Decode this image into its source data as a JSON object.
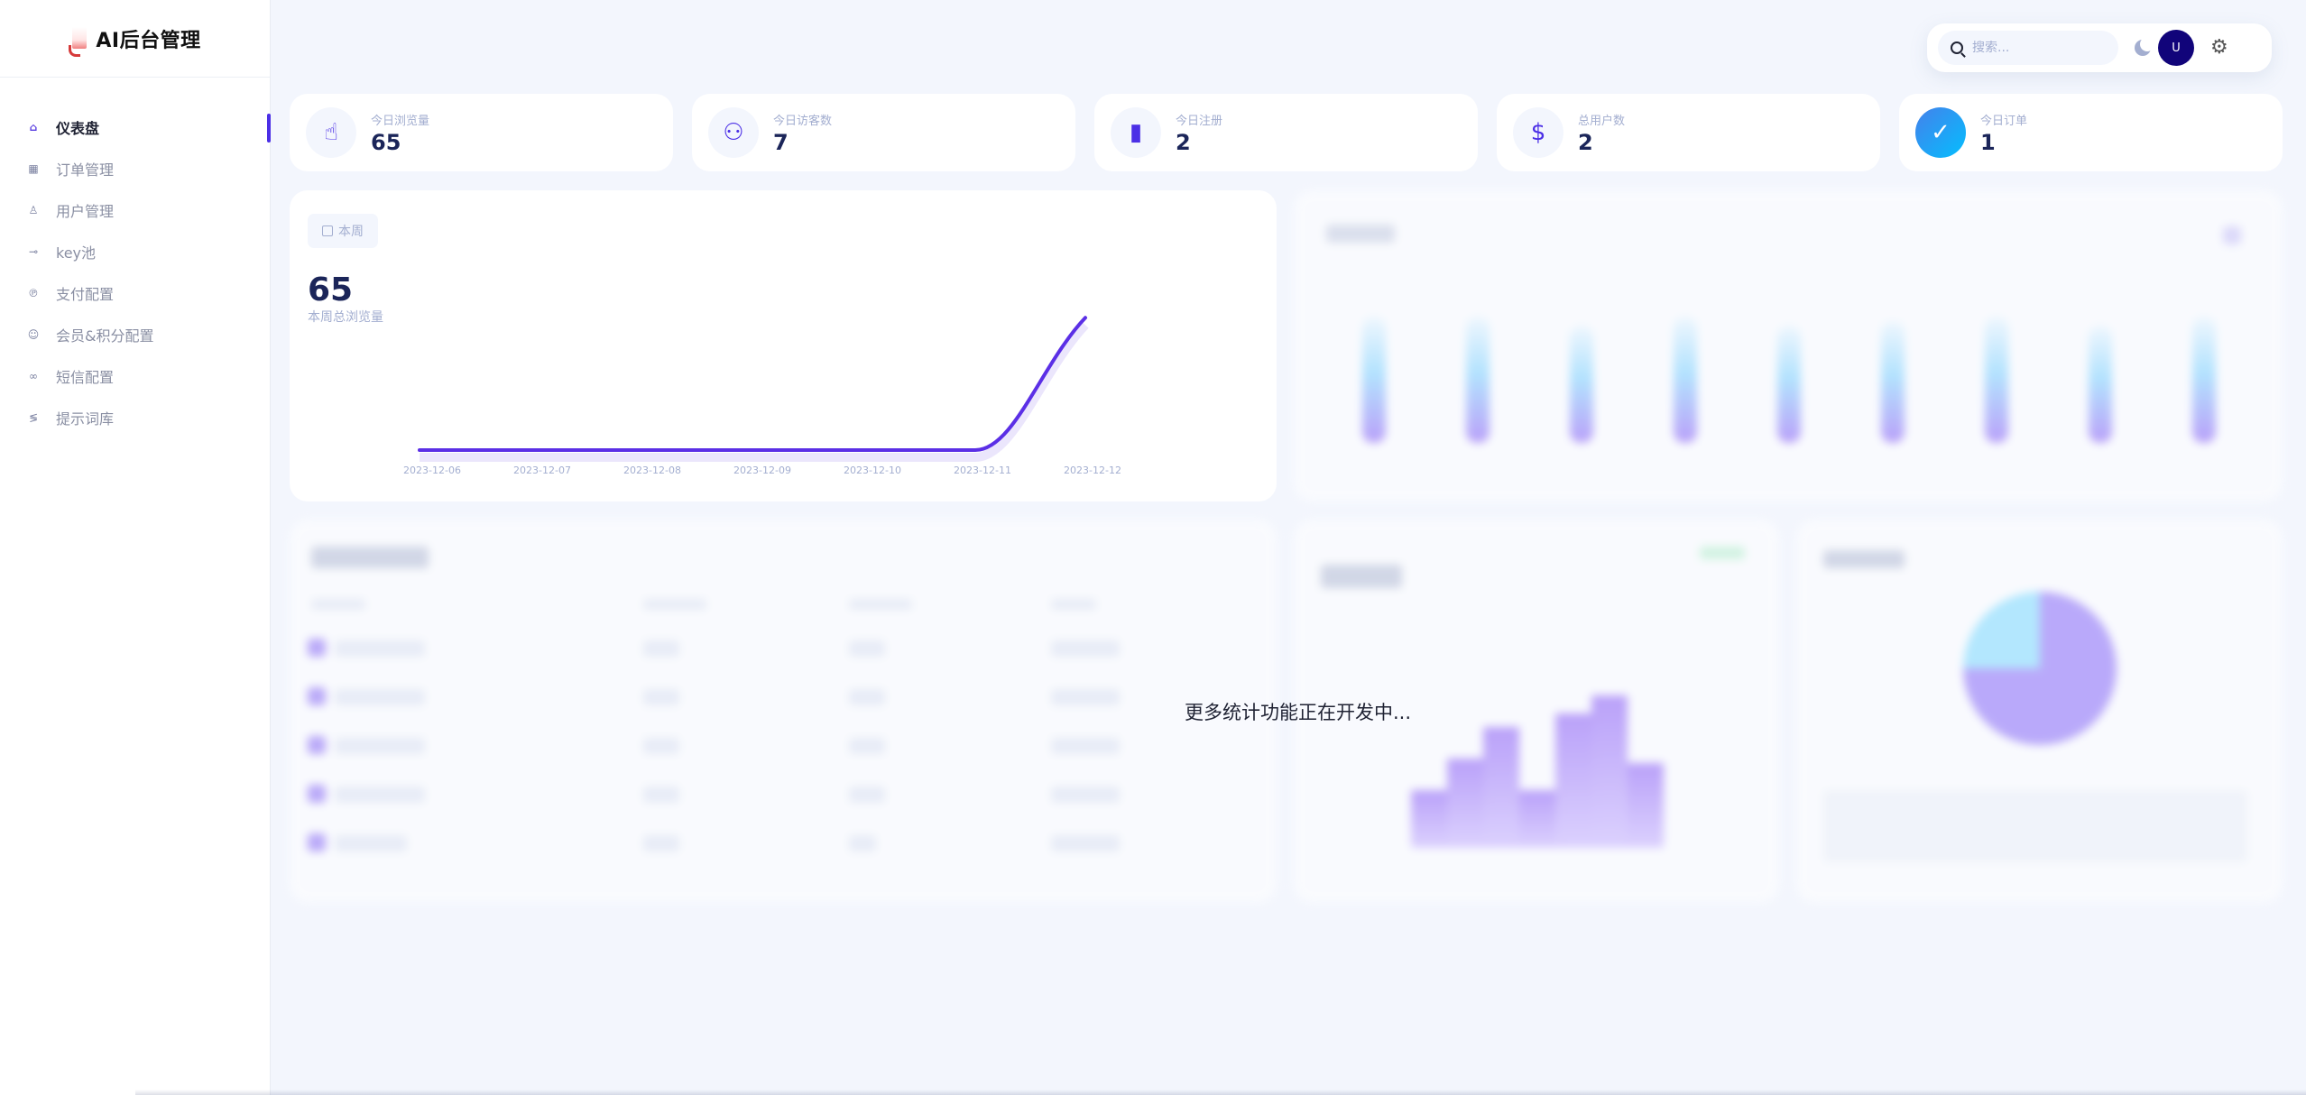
{
  "brand": {
    "title": "AI后台管理"
  },
  "sidebar": {
    "items": [
      {
        "label": "仪表盘",
        "icon": "home-icon",
        "active": true
      },
      {
        "label": "订单管理",
        "icon": "grid-icon",
        "active": false
      },
      {
        "label": "用户管理",
        "icon": "user-icon",
        "active": false
      },
      {
        "label": "key池",
        "icon": "key-icon",
        "active": false
      },
      {
        "label": "支付配置",
        "icon": "payment-icon",
        "active": false
      },
      {
        "label": "会员&积分配置",
        "icon": "member-icon",
        "active": false
      },
      {
        "label": "短信配置",
        "icon": "sms-icon",
        "active": false
      },
      {
        "label": "提示词库",
        "icon": "prompt-icon",
        "active": false
      }
    ]
  },
  "topbar": {
    "search_placeholder": "搜索...",
    "avatar_initial": "U"
  },
  "stats": [
    {
      "label": "今日浏览量",
      "value": "65",
      "icon": "hand-pointer-icon"
    },
    {
      "label": "今日访客数",
      "value": "7",
      "icon": "people-icon"
    },
    {
      "label": "今日注册",
      "value": "2",
      "icon": "bar-chart-icon"
    },
    {
      "label": "总用户数",
      "value": "2",
      "icon": "dollar-icon"
    },
    {
      "label": "今日订单",
      "value": "1",
      "icon": "check-plus-icon"
    }
  ],
  "weekly": {
    "button_label": "本周",
    "total_value": "65",
    "total_label": "本周总浏览量"
  },
  "chart_data": {
    "type": "line",
    "x": [
      "2023-12-06",
      "2023-12-07",
      "2023-12-08",
      "2023-12-09",
      "2023-12-10",
      "2023-12-11",
      "2023-12-12"
    ],
    "series": [
      {
        "values": [
          0,
          0,
          0,
          0,
          0,
          0,
          65
        ]
      }
    ],
    "ylim": [
      0,
      70
    ],
    "color": "#5b2fe6"
  },
  "message": "更多统计功能正在开发中..."
}
